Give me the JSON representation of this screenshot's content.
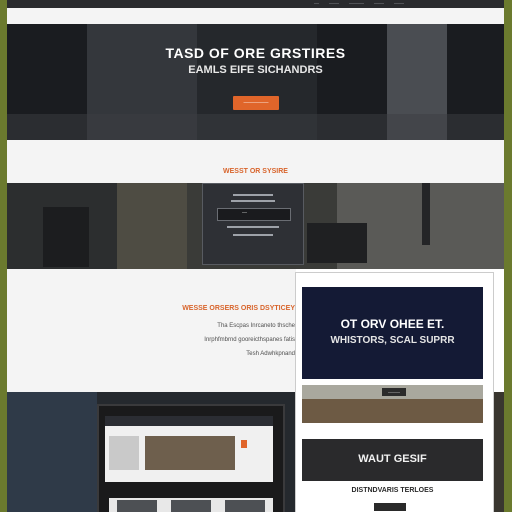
{
  "nav": {
    "links": [
      "—",
      "——",
      "———",
      "——",
      "——"
    ]
  },
  "hero": {
    "title": "TASD OF ORE GRSTIRES",
    "subtitle": "EAMLS EIFE SICHANDRS",
    "cta_label": "—————"
  },
  "section": {
    "label": "WESST OR SYSIRE"
  },
  "desk_screen": {
    "search_text": "—"
  },
  "content": {
    "heading": "WESSE ORSERS ORIS DSYTICEY",
    "lines": [
      "Tha Escpas Inrcaneto thsche",
      "Inrphfmbrnd gooreicthspanes fatis",
      "Tesh Adwhkpnand"
    ]
  },
  "card": {
    "banner_title": "OT ORV OHEE ET.",
    "banner_sub": "WHISTORS, SCAL SUPRR",
    "photo_button": "———",
    "dark_title": "WAUT GESIF",
    "footer_text": "DISTNDVARIS TERLOES"
  },
  "colors": {
    "accent": "#e0652a",
    "navy": "#141a35"
  }
}
